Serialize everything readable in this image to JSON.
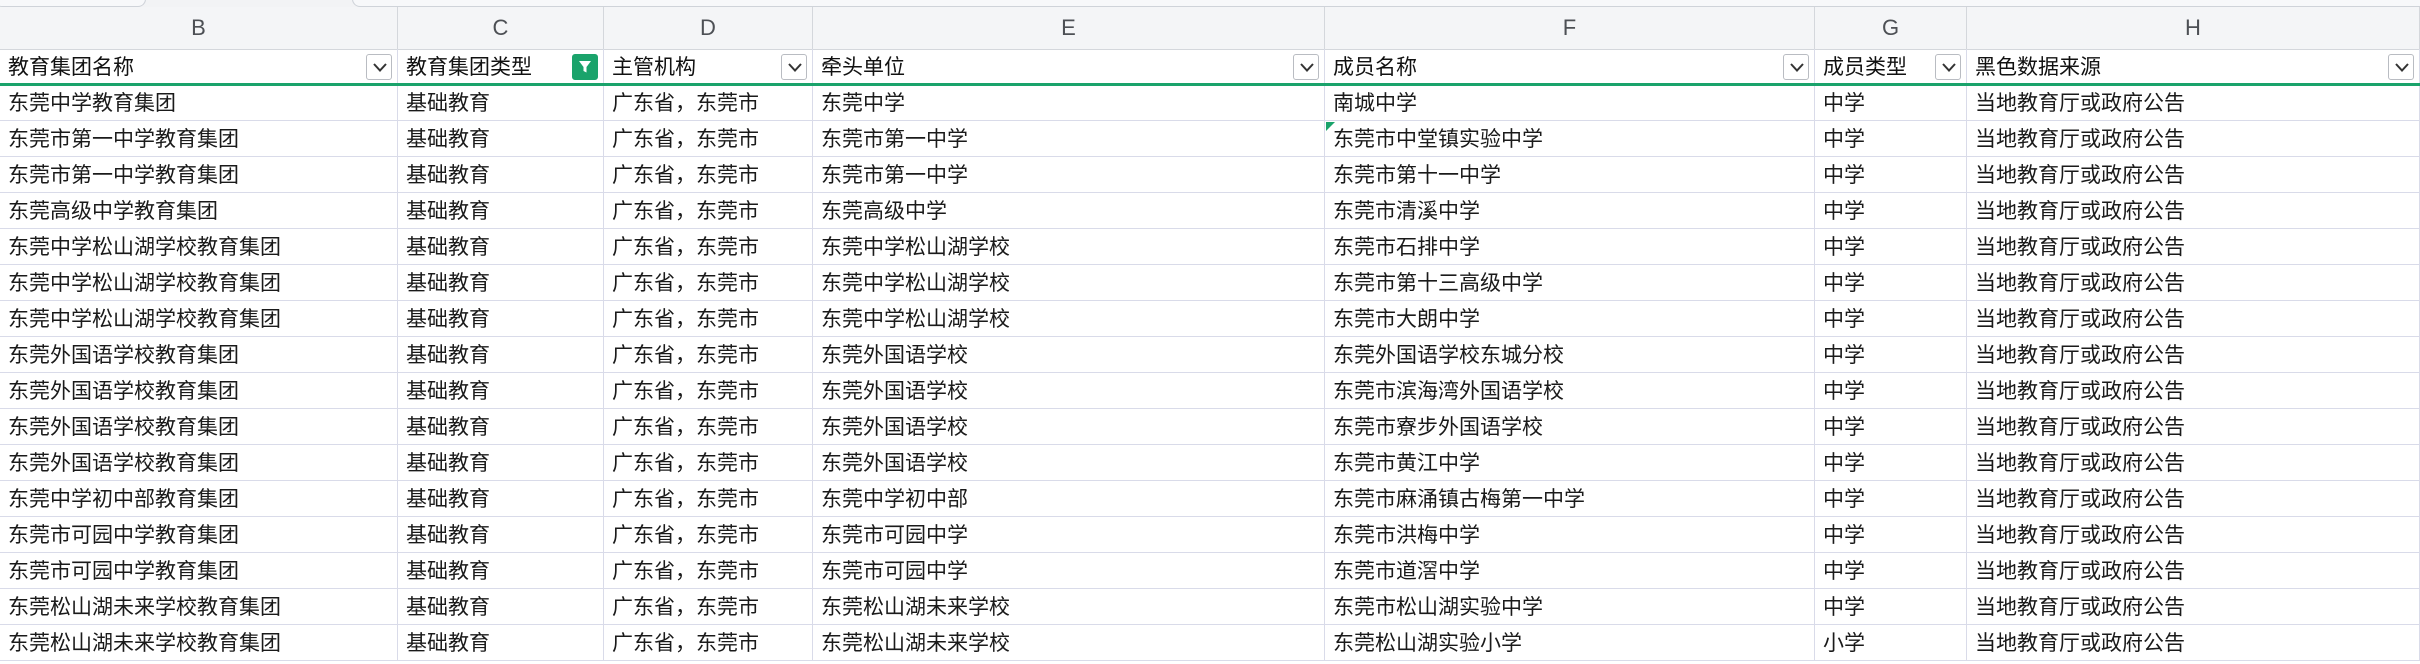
{
  "columns": [
    "B",
    "C",
    "D",
    "E",
    "F",
    "G",
    "H"
  ],
  "headers": [
    "教育集团名称",
    "教育集团类型",
    "主管机构",
    "牵头单位",
    "成员名称",
    "成员类型",
    "黑色数据来源"
  ],
  "filter_active_column": "C",
  "colors": {
    "accent": "#1aa36b",
    "grid": "#d9dbe9",
    "header_bg": "#f4f5f7"
  },
  "rows": [
    [
      "东莞中学教育集团",
      "基础教育",
      "广东省，东莞市",
      "东莞中学",
      "南城中学",
      "中学",
      "当地教育厅或政府公告"
    ],
    [
      "东莞市第一中学教育集团",
      "基础教育",
      "广东省，东莞市",
      "东莞市第一中学",
      "东莞市中堂镇实验中学",
      "中学",
      "当地教育厅或政府公告"
    ],
    [
      "东莞市第一中学教育集团",
      "基础教育",
      "广东省，东莞市",
      "东莞市第一中学",
      "东莞市第十一中学",
      "中学",
      "当地教育厅或政府公告"
    ],
    [
      "东莞高级中学教育集团",
      "基础教育",
      "广东省，东莞市",
      "东莞高级中学",
      "东莞市清溪中学",
      "中学",
      "当地教育厅或政府公告"
    ],
    [
      "东莞中学松山湖学校教育集团",
      "基础教育",
      "广东省，东莞市",
      "东莞中学松山湖学校",
      "东莞市石排中学",
      "中学",
      "当地教育厅或政府公告"
    ],
    [
      "东莞中学松山湖学校教育集团",
      "基础教育",
      "广东省，东莞市",
      "东莞中学松山湖学校",
      "东莞市第十三高级中学",
      "中学",
      "当地教育厅或政府公告"
    ],
    [
      "东莞中学松山湖学校教育集团",
      "基础教育",
      "广东省，东莞市",
      "东莞中学松山湖学校",
      "东莞市大朗中学",
      "中学",
      "当地教育厅或政府公告"
    ],
    [
      "东莞外国语学校教育集团",
      "基础教育",
      "广东省，东莞市",
      "东莞外国语学校",
      "东莞外国语学校东城分校",
      "中学",
      "当地教育厅或政府公告"
    ],
    [
      "东莞外国语学校教育集团",
      "基础教育",
      "广东省，东莞市",
      "东莞外国语学校",
      "东莞市滨海湾外国语学校",
      "中学",
      "当地教育厅或政府公告"
    ],
    [
      "东莞外国语学校教育集团",
      "基础教育",
      "广东省，东莞市",
      "东莞外国语学校",
      "东莞市寮步外国语学校",
      "中学",
      "当地教育厅或政府公告"
    ],
    [
      "东莞外国语学校教育集团",
      "基础教育",
      "广东省，东莞市",
      "东莞外国语学校",
      "东莞市黄江中学",
      "中学",
      "当地教育厅或政府公告"
    ],
    [
      "东莞中学初中部教育集团",
      "基础教育",
      "广东省，东莞市",
      "东莞中学初中部",
      "东莞市麻涌镇古梅第一中学",
      "中学",
      "当地教育厅或政府公告"
    ],
    [
      "东莞市可园中学教育集团",
      "基础教育",
      "广东省，东莞市",
      "东莞市可园中学",
      "东莞市洪梅中学",
      "中学",
      "当地教育厅或政府公告"
    ],
    [
      "东莞市可园中学教育集团",
      "基础教育",
      "广东省，东莞市",
      "东莞市可园中学",
      "东莞市道滘中学",
      "中学",
      "当地教育厅或政府公告"
    ],
    [
      "东莞松山湖未来学校教育集团",
      "基础教育",
      "广东省，东莞市",
      "东莞松山湖未来学校",
      "东莞市松山湖实验中学",
      "中学",
      "当地教育厅或政府公告"
    ],
    [
      "东莞松山湖未来学校教育集团",
      "基础教育",
      "广东省，东莞市",
      "东莞松山湖未来学校",
      "东莞松山湖实验小学",
      "小学",
      "当地教育厅或政府公告"
    ]
  ]
}
